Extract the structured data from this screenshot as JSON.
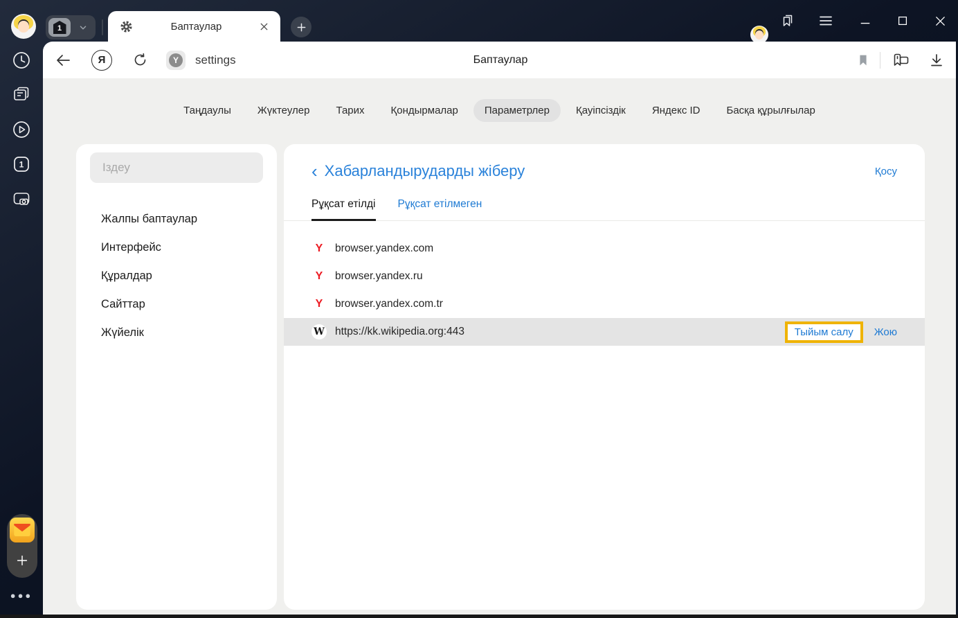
{
  "titlebar": {
    "tab_count": "1",
    "tab_title": "Баптаулар"
  },
  "toolbar": {
    "address": "settings",
    "page_title": "Баптаулар"
  },
  "settings_nav": {
    "items": [
      {
        "label": "Таңдаулы"
      },
      {
        "label": "Жүктеулер"
      },
      {
        "label": "Тарих"
      },
      {
        "label": "Қондырмалар"
      },
      {
        "label": "Параметрлер"
      },
      {
        "label": "Қауіпсіздік"
      },
      {
        "label": "Яндекс ID"
      },
      {
        "label": "Басқа құрылғылар"
      }
    ],
    "active_index": 4
  },
  "sidebar": {
    "search_placeholder": "Іздеу",
    "items": [
      {
        "label": "Жалпы баптаулар"
      },
      {
        "label": "Интерфейс"
      },
      {
        "label": "Құралдар"
      },
      {
        "label": "Сайттар"
      },
      {
        "label": "Жүйелік"
      }
    ]
  },
  "panel": {
    "back_glyph": "‹",
    "title": "Хабарландырударды жіберу",
    "add_label": "Қосу",
    "tabs": [
      {
        "label": "Рұқсат етілді"
      },
      {
        "label": "Рұқсат етілмеген"
      }
    ],
    "active_tab_index": 0,
    "sites": [
      {
        "favicon": "Y",
        "domain": "browser.yandex.com"
      },
      {
        "favicon": "Y",
        "domain": "browser.yandex.ru"
      },
      {
        "favicon": "Y",
        "domain": "browser.yandex.com.tr"
      },
      {
        "favicon": "W",
        "domain": "https://kk.wikipedia.org:443",
        "highlighted": true,
        "block_label": "Тыйым салу",
        "delete_label": "Жою"
      }
    ]
  },
  "colors": {
    "accent_blue": "#1e7ad3",
    "annotation_highlight": "#efb303",
    "row_highlight": "#e4e4e4",
    "yandex_red": "#ec1c24"
  }
}
